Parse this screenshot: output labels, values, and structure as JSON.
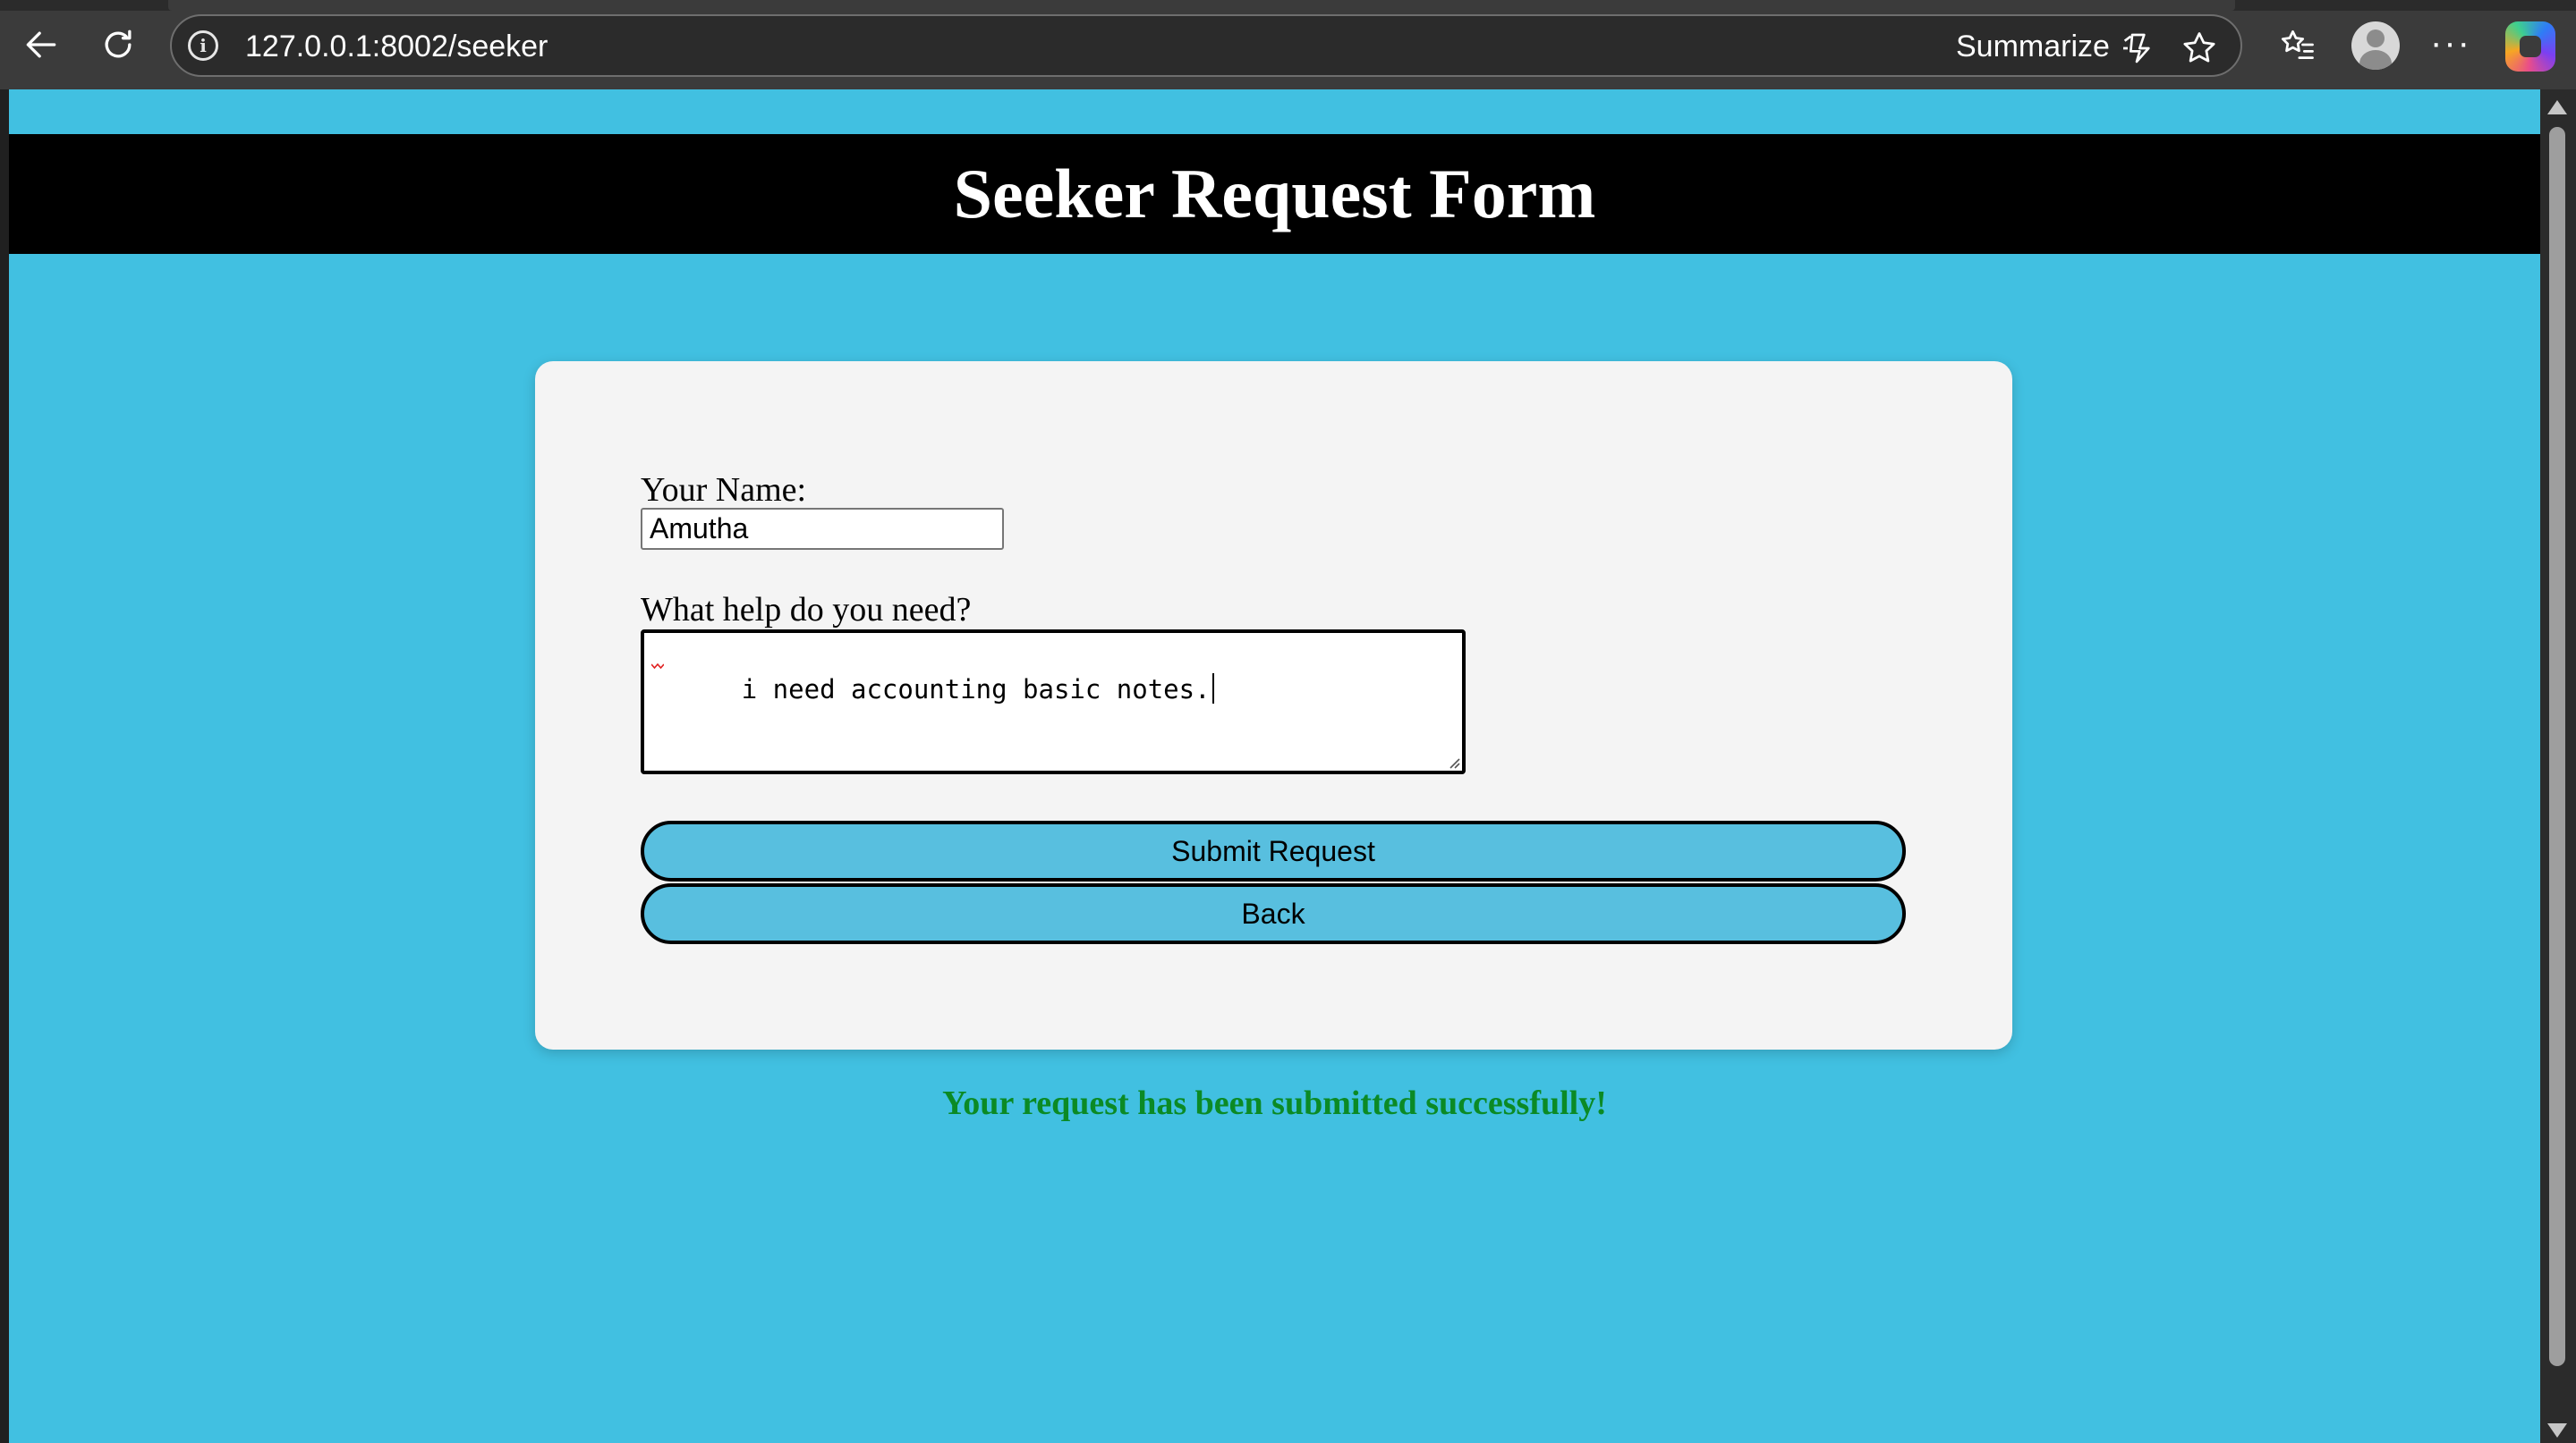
{
  "browser": {
    "url": "127.0.0.1:8002/seeker",
    "summarize_label": "Summarize",
    "icons": {
      "back": "back-arrow-icon",
      "refresh": "refresh-icon",
      "site_info": "info-icon",
      "summarize": "summarize-icon",
      "favorite": "star-icon",
      "favorites_list": "favorites-icon",
      "profile": "avatar-icon",
      "menu": "more-icon",
      "copilot": "copilot-icon"
    },
    "info_glyph": "i",
    "more_glyph": "···"
  },
  "page": {
    "title": "Seeker Request Form",
    "background_color": "#41c0e1",
    "form": {
      "name_label": "Your Name:",
      "name_value": "Amutha",
      "help_label": "What help do you need?",
      "help_value": "i need accounting basic notes.",
      "submit_label": "Submit Request",
      "back_label": "Back"
    },
    "success_message": "Your request has been submitted successfully!",
    "colors": {
      "header": "#000000",
      "card": "#f4f4f4",
      "button": "#58bfdf",
      "success": "#0b8a25"
    }
  }
}
